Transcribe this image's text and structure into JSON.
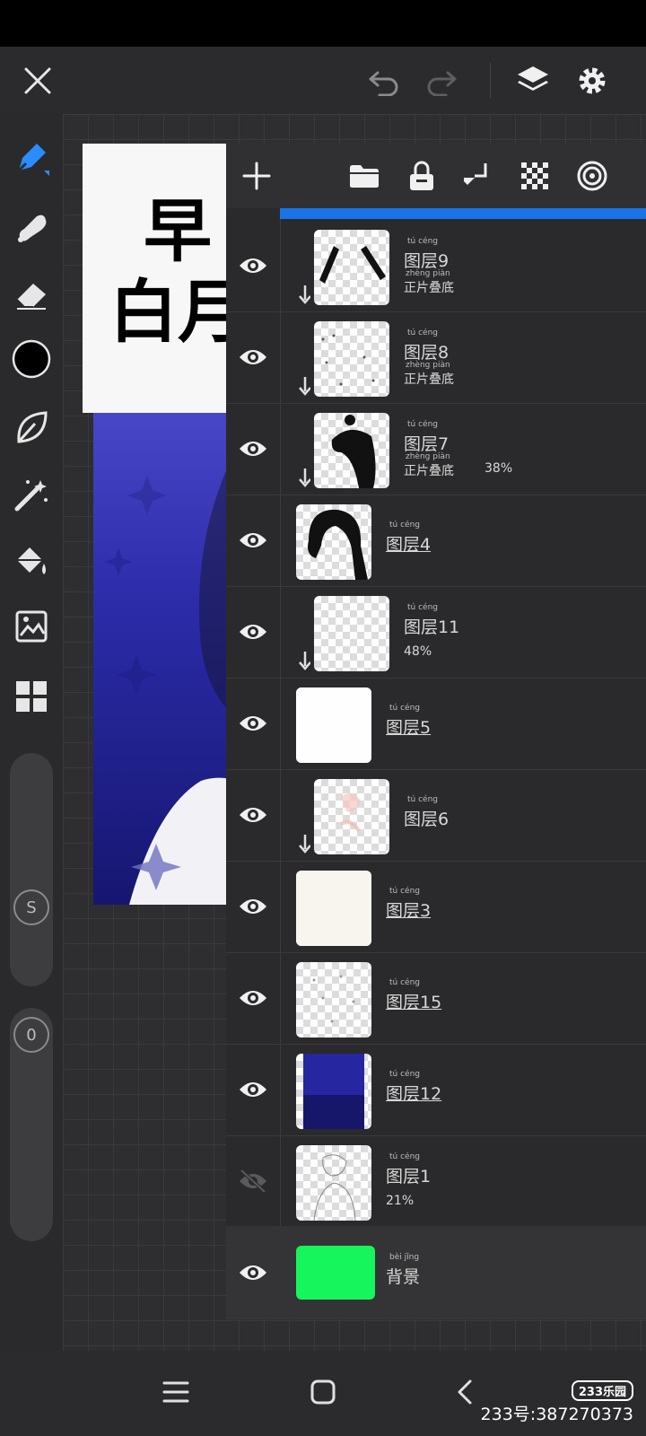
{
  "colors": {
    "accent": "#1a73e8",
    "current_color": "#000000",
    "background_fill": "#17f55c",
    "art_blue": "#2b2ba8"
  },
  "icons": {
    "close": "close-icon",
    "undo": "undo-icon",
    "redo": "redo-icon",
    "layers": "layers-icon",
    "settings": "gear-icon",
    "tools": [
      "pen-icon",
      "smudge-icon",
      "eraser-icon",
      "color-swatch",
      "leaf-icon",
      "magic-wand-icon",
      "paint-bucket-icon",
      "image-icon",
      "grid-icon"
    ],
    "panel": [
      "add-icon",
      "folder-icon",
      "lock-icon",
      "merge-down-icon",
      "checker-icon",
      "radial-icon"
    ]
  },
  "sliders": {
    "size_label": "S",
    "opacity_label": "0"
  },
  "canvas_text": {
    "line1": "早",
    "line2": "白月"
  },
  "layers": [
    {
      "name": "图层9",
      "ruby": "tú céng",
      "blend": "正片叠底",
      "blend_ruby": "zhèng piàn",
      "opacity": "",
      "visible": true,
      "clipped": true
    },
    {
      "name": "图层8",
      "ruby": "tú céng",
      "blend": "正片叠底",
      "blend_ruby": "zhèng piàn",
      "opacity": "",
      "visible": true,
      "clipped": true
    },
    {
      "name": "图层7",
      "ruby": "tú céng",
      "blend": "正片叠底",
      "blend_ruby": "zhèng piàn",
      "opacity": "38%",
      "visible": true,
      "clipped": true
    },
    {
      "name": "图层4",
      "ruby": "tú céng",
      "blend": "",
      "blend_ruby": "",
      "opacity": "",
      "visible": true,
      "clipped": false
    },
    {
      "name": "图层11",
      "ruby": "tú céng",
      "blend": "",
      "blend_ruby": "",
      "opacity": "48%",
      "visible": true,
      "clipped": true
    },
    {
      "name": "图层5",
      "ruby": "tú céng",
      "blend": "",
      "blend_ruby": "",
      "opacity": "",
      "visible": true,
      "clipped": false
    },
    {
      "name": "图层6",
      "ruby": "tú céng",
      "blend": "",
      "blend_ruby": "",
      "opacity": "",
      "visible": true,
      "clipped": true
    },
    {
      "name": "图层3",
      "ruby": "tú céng",
      "blend": "",
      "blend_ruby": "",
      "opacity": "",
      "visible": true,
      "clipped": false
    },
    {
      "name": "图层15",
      "ruby": "tú céng",
      "blend": "",
      "blend_ruby": "",
      "opacity": "",
      "visible": true,
      "clipped": false
    },
    {
      "name": "图层12",
      "ruby": "tú céng",
      "blend": "",
      "blend_ruby": "",
      "opacity": "",
      "visible": true,
      "clipped": false
    },
    {
      "name": "图层1",
      "ruby": "tú céng",
      "blend": "",
      "blend_ruby": "",
      "opacity": "21%",
      "visible": false,
      "clipped": false
    },
    {
      "name": "背景",
      "ruby": "bèi jǐng",
      "blend": "",
      "blend_ruby": "",
      "opacity": "",
      "visible": true,
      "clipped": false
    }
  ],
  "watermark": {
    "logo": "233乐园",
    "text": "233号:387270373"
  }
}
